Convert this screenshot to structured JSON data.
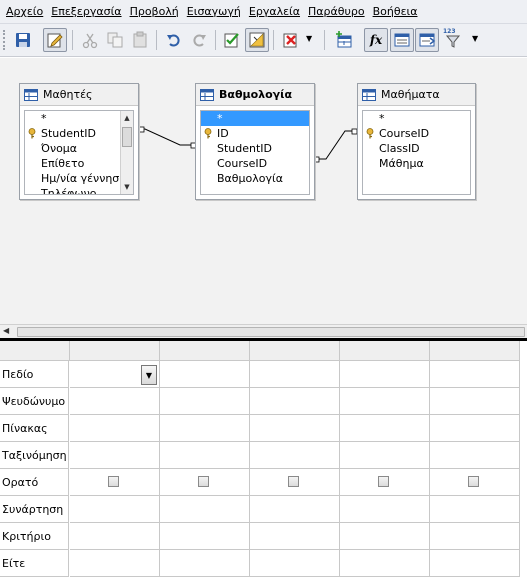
{
  "menu": [
    "Αρχείο",
    "Επεξεργασία",
    "Προβολή",
    "Εισαγωγή",
    "Εργαλεία",
    "Παράθυρο",
    "Βοήθεια"
  ],
  "toolbar": {
    "icons": [
      "save-icon",
      "edit-mode-icon",
      "cut-icon",
      "copy-icon",
      "paste-icon",
      "undo-icon",
      "redo-icon",
      "run-query-icon",
      "design-view-icon",
      "clear-query-icon",
      "add-tables-icon",
      "functions-icon",
      "table-name-icon",
      "alias-icon",
      "distinct-values-icon"
    ],
    "functions_glyph": "fx",
    "limit_glyph": "123"
  },
  "tables": [
    {
      "title": "Μαθητές",
      "fields": [
        {
          "name": "*",
          "key": false
        },
        {
          "name": "StudentID",
          "key": true
        },
        {
          "name": "Όνομα",
          "key": false
        },
        {
          "name": "Επίθετο",
          "key": false
        },
        {
          "name": "Ημ/νία γέννησης",
          "key": false
        },
        {
          "name": "Τηλέφωνο",
          "key": false
        }
      ]
    },
    {
      "title": "Βαθμολογία",
      "fields": [
        {
          "name": "*",
          "key": false,
          "selected": true
        },
        {
          "name": "ID",
          "key": true
        },
        {
          "name": "StudentID",
          "key": false
        },
        {
          "name": "CourseID",
          "key": false
        },
        {
          "name": "Βαθμολογία",
          "key": false
        }
      ]
    },
    {
      "title": "Μαθήματα",
      "fields": [
        {
          "name": "*",
          "key": false
        },
        {
          "name": "CourseID",
          "key": true
        },
        {
          "name": "ClassID",
          "key": false
        },
        {
          "name": "Μάθημα",
          "key": false
        }
      ]
    }
  ],
  "grid": {
    "row_labels": [
      "Πεδίο",
      "Ψευδώνυμο",
      "Πίνακας",
      "Ταξινόμηση",
      "Ορατό",
      "Συνάρτηση",
      "Κριτήριο",
      "Είτε"
    ],
    "columns": 5,
    "visible_checked": [
      false,
      false,
      false,
      false,
      false
    ]
  },
  "colors": {
    "selection": "#3399ff",
    "canvas": "#f2f2f2",
    "toolbar": "#eef0f4"
  }
}
